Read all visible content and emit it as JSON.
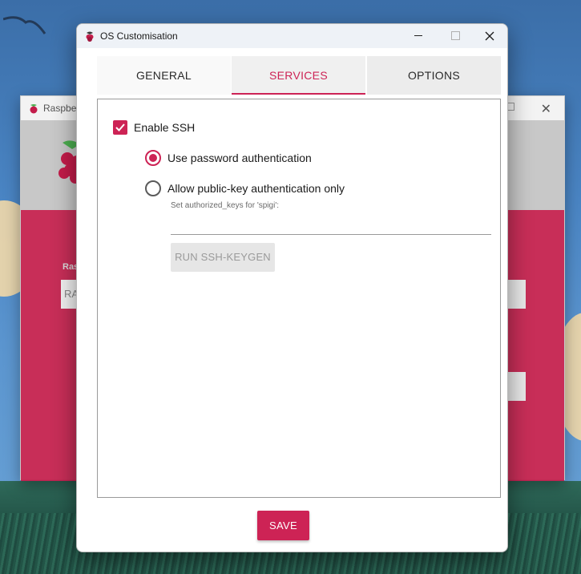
{
  "dialog": {
    "title": "OS Customisation",
    "tabs": [
      {
        "label": "GENERAL"
      },
      {
        "label": "SERVICES"
      },
      {
        "label": "OPTIONS"
      }
    ],
    "active_tab": "SERVICES",
    "services": {
      "enable_ssh_label": "Enable SSH",
      "enable_ssh_checked": true,
      "password_auth_label": "Use password authentication",
      "password_auth_selected": true,
      "public_key_label": "Allow public-key authentication only",
      "public_key_selected": false,
      "authorized_keys_hint": "Set authorized_keys for 'spigi':",
      "authorized_keys_value": "",
      "keygen_button": "RUN SSH-KEYGEN"
    },
    "save_button": "SAVE"
  },
  "background_window": {
    "title": "Raspberr",
    "partial_label": "Ras",
    "partial_button": "RA"
  },
  "colors": {
    "accent": "#cd2355",
    "titlebar": "#eef2f7",
    "disabled_button": "#e6e6e6"
  }
}
